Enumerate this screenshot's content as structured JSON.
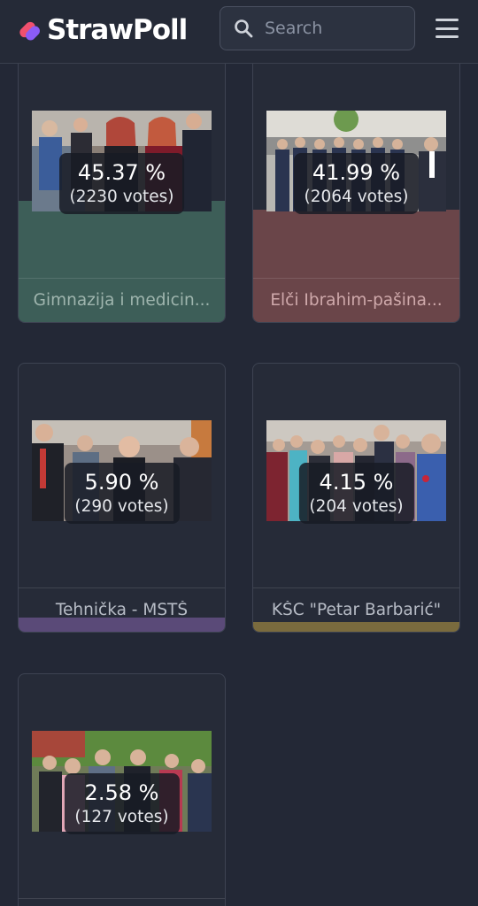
{
  "header": {
    "brand": "StrawPoll",
    "search_placeholder": "Search",
    "icons": {
      "logo": "strawpoll-logo-icon",
      "search": "search-icon",
      "menu": "hamburger-menu-icon"
    }
  },
  "options": [
    {
      "label": "Gimnazija i medicin...",
      "percent": "45.37 %",
      "votes": "(2230 votes)",
      "share": 45.37,
      "color": "#3d5e58"
    },
    {
      "label": "Elči Ibrahim-pašina...",
      "percent": "41.99 %",
      "votes": "(2064 votes)",
      "share": 41.99,
      "color": "#6a4549"
    },
    {
      "label": "Tehnička - MSTŠ",
      "percent": "5.90 %",
      "votes": "(290 votes)",
      "share": 5.9,
      "color": "#5a4a78"
    },
    {
      "label": "KŠC \"Petar Barbarić\"",
      "percent": "4.15 %",
      "votes": "(204 votes)",
      "share": 4.15,
      "color": "#7a6b3e"
    },
    {
      "label": "",
      "percent": "2.58 %",
      "votes": "(127 votes)",
      "share": 2.58,
      "color": "#3b4a6b"
    }
  ]
}
